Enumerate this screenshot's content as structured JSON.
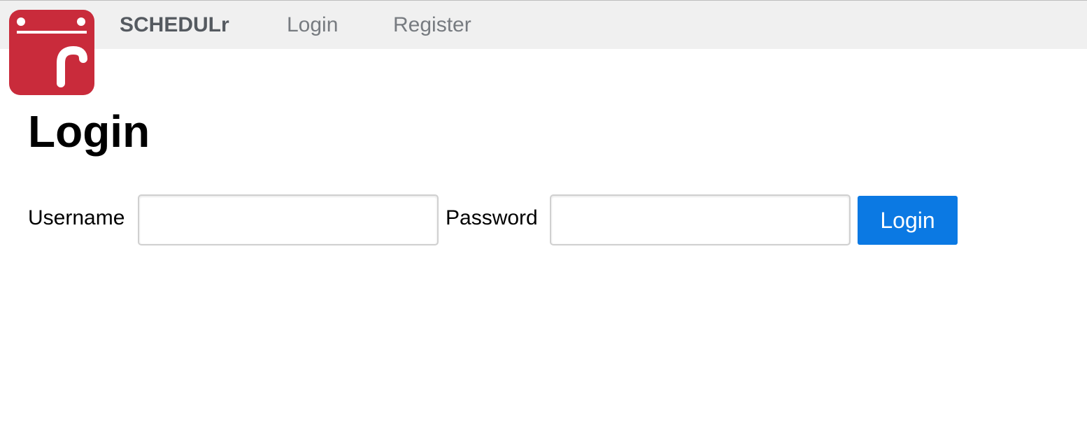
{
  "brand": {
    "name": "SCHEDULr",
    "logo_icon": "calendar-r-logo-icon",
    "logo_color": "#c92b3b"
  },
  "nav": {
    "links": [
      {
        "label": "Login"
      },
      {
        "label": "Register"
      }
    ]
  },
  "page": {
    "title": "Login"
  },
  "form": {
    "username_label": "Username",
    "username_value": "",
    "password_label": "Password",
    "password_value": "",
    "submit_label": "Login"
  },
  "colors": {
    "navbar_bg": "#f0f0f0",
    "primary_button": "#0b79e3"
  }
}
